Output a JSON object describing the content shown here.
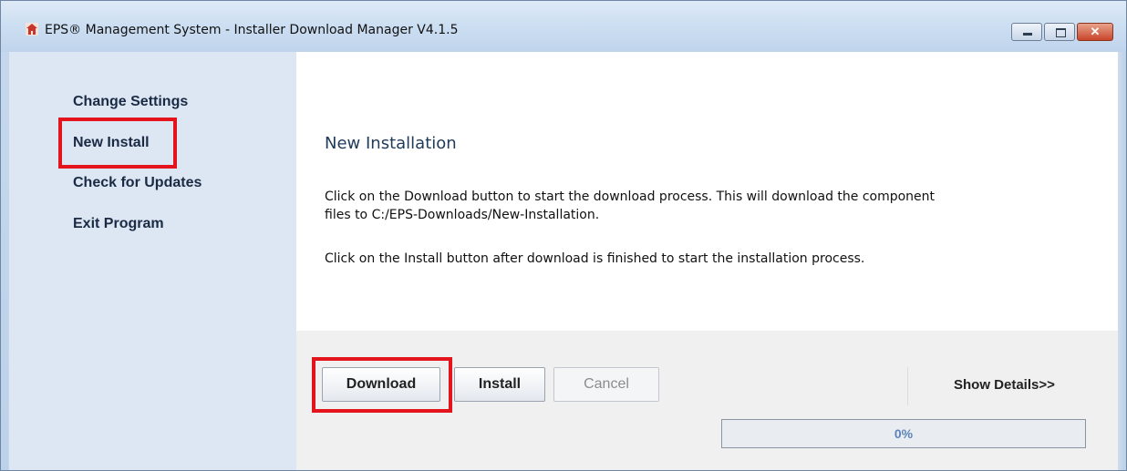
{
  "window": {
    "title": "EPS® Management System -  Installer Download Manager V4.1.5",
    "controls": {
      "close_glyph": "✕"
    }
  },
  "sidebar": {
    "items": [
      {
        "label": "Change Settings"
      },
      {
        "label": "New Install",
        "highlighted": true
      },
      {
        "label": "Check for Updates"
      },
      {
        "label": "Exit Program"
      }
    ]
  },
  "content": {
    "title": "New Installation",
    "paragraph1_line1": "Click on the Download button to start the download process. This will download the component",
    "paragraph1_line2": "files to C:/EPS-Downloads/New-Installation.",
    "paragraph2": "Click on the Install button after download is finished to start the installation process."
  },
  "actions": {
    "download_label": "Download",
    "install_label": "Install",
    "cancel_label": "Cancel",
    "show_details_label": "Show Details>>"
  },
  "progress": {
    "value": 0,
    "label": "0%"
  },
  "colors": {
    "highlight": "#e3141b",
    "sidebar_bg": "#dde7f3",
    "titlebar_bg": "#cddff2"
  }
}
